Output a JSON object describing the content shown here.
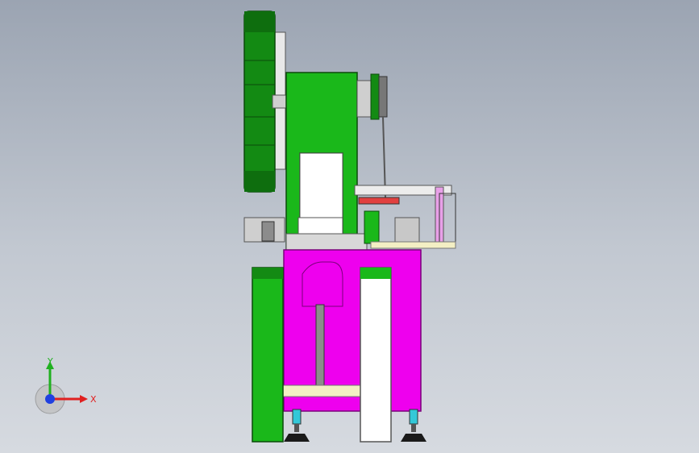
{
  "viewport": {
    "background_top": "#9ba4b2",
    "background_bottom": "#d6dae0"
  },
  "colors": {
    "frame_green": "#1ab81a",
    "flywheel_green": "#138a13",
    "base_magenta": "#ee00ee",
    "panel_white": "#ffffff",
    "shaft_gray": "#8c8c8c",
    "plate_cream": "#f3efc4",
    "foot_black": "#1a1a1a",
    "foot_cyan": "#33c8d8"
  },
  "triad": {
    "x_label": "X",
    "y_label": "Y",
    "x_color": "#e02020",
    "y_color": "#20b020",
    "z_color": "#2040e0"
  }
}
